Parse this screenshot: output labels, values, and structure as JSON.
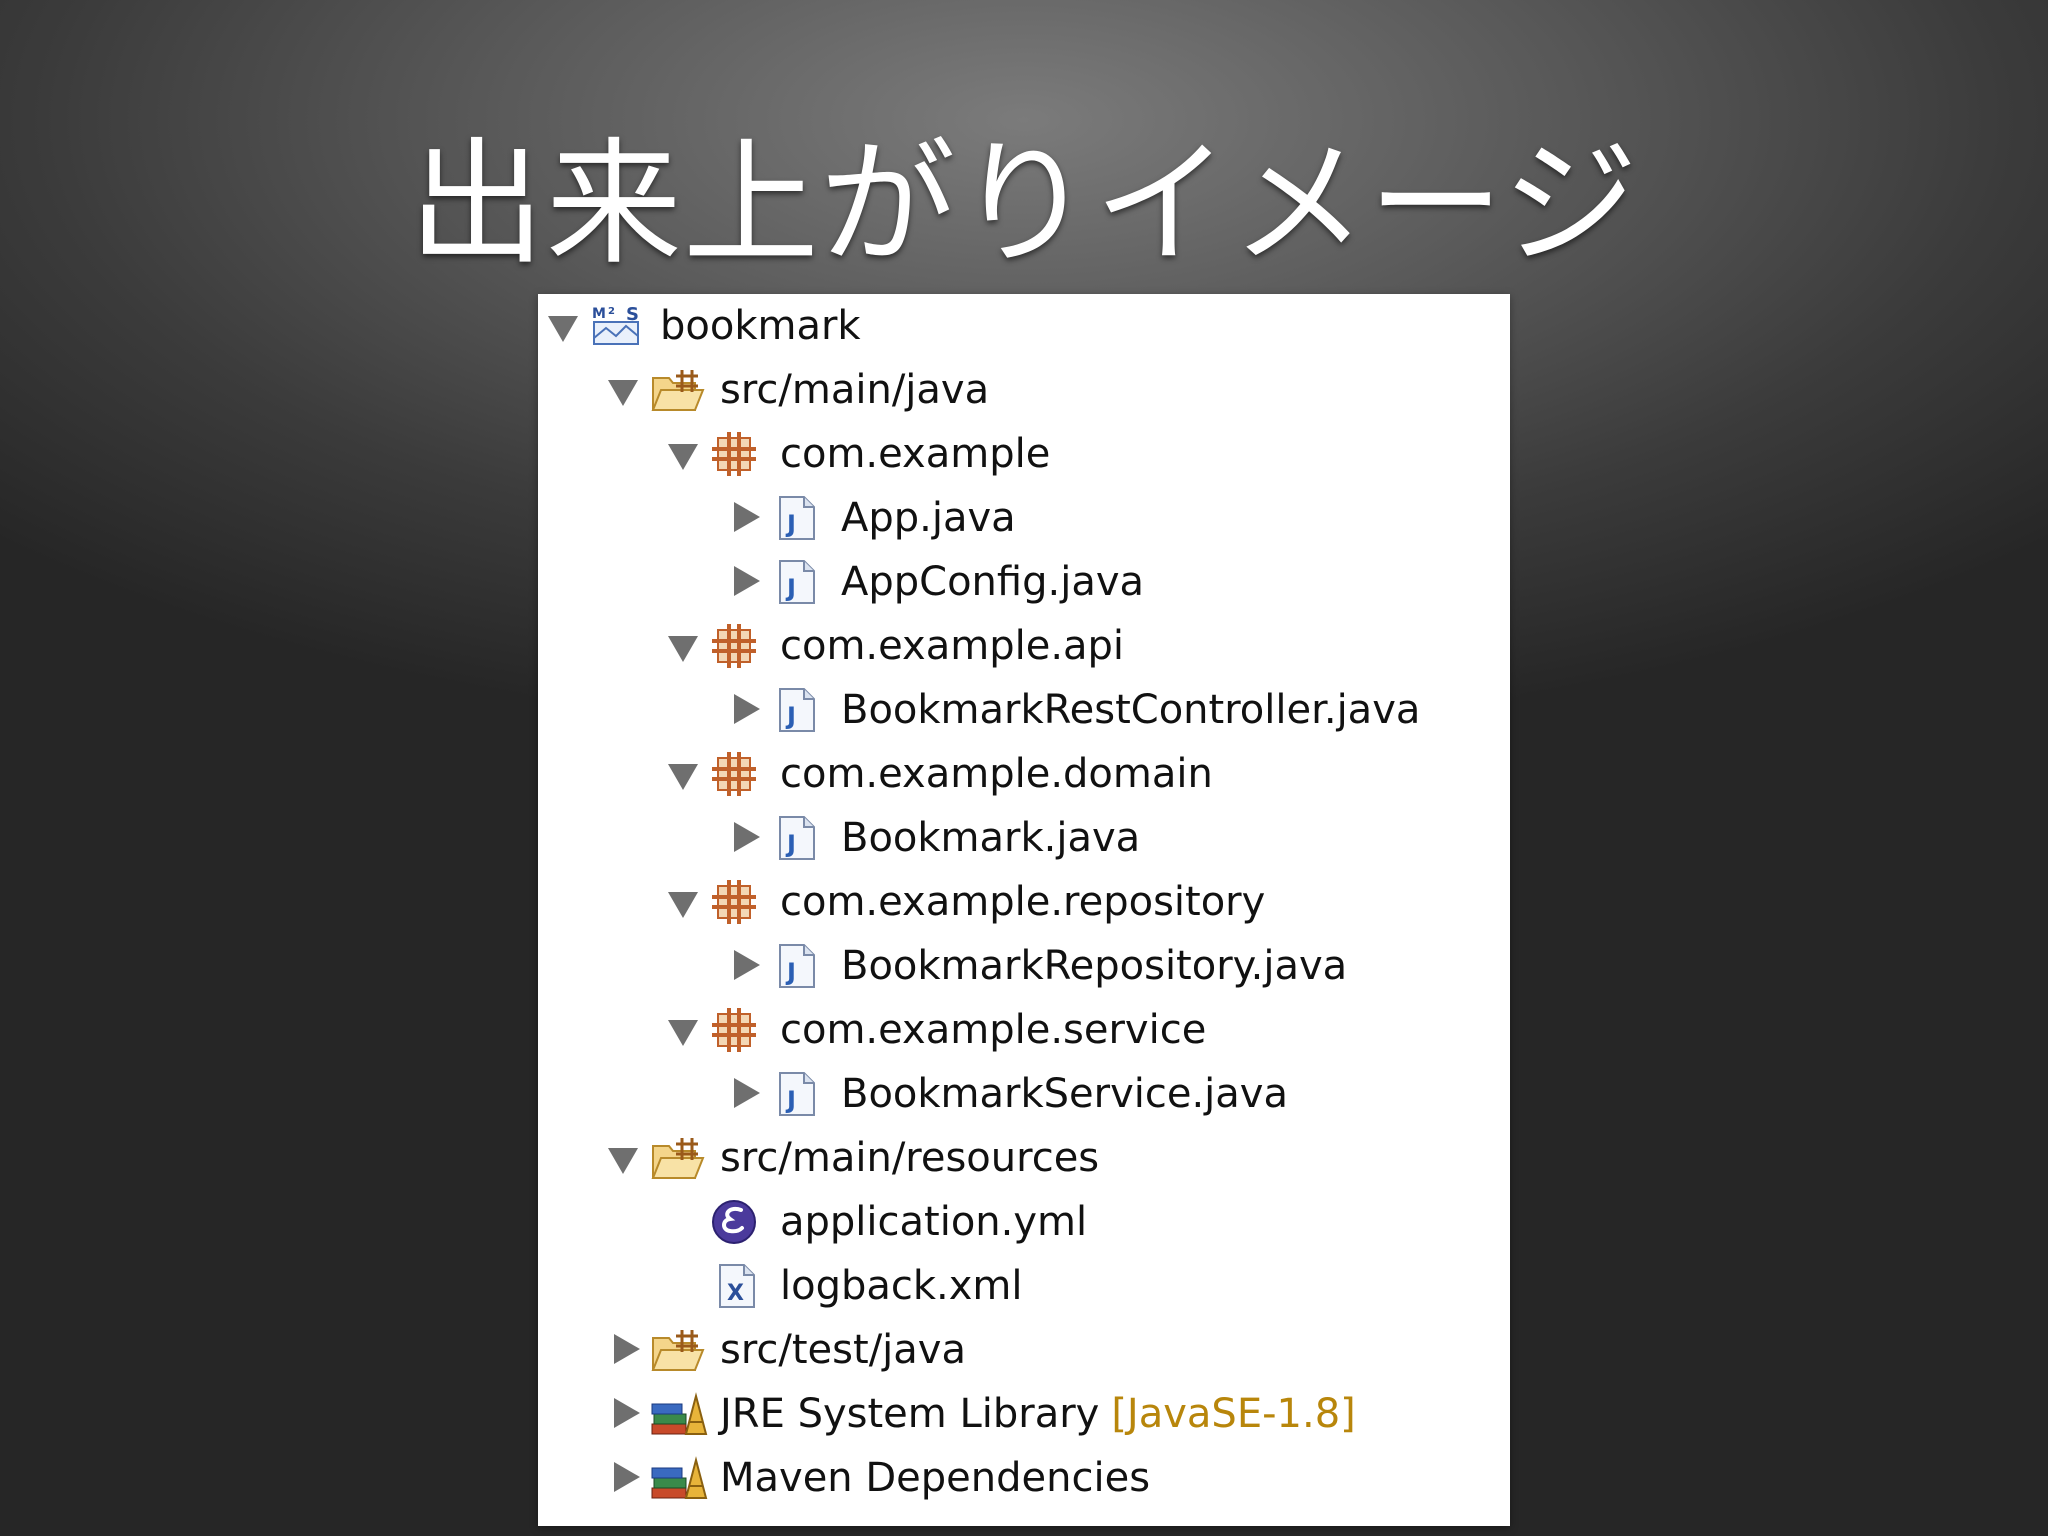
{
  "slide": {
    "title": "出来上がりイメージ"
  },
  "tree": {
    "project": "bookmark",
    "src_main_java": "src/main/java",
    "pkg_com_example": "com.example",
    "file_app_java": "App.java",
    "file_appconfig_java": "AppConfig.java",
    "pkg_api": "com.example.api",
    "file_bookmark_rest_controller": "BookmarkRestController.java",
    "pkg_domain": "com.example.domain",
    "file_bookmark_java": "Bookmark.java",
    "pkg_repository": "com.example.repository",
    "file_bookmark_repository": "BookmarkRepository.java",
    "pkg_service": "com.example.service",
    "file_bookmark_service": "BookmarkService.java",
    "src_main_resources": "src/main/resources",
    "file_application_yml": "application.yml",
    "file_logback_xml": "logback.xml",
    "src_test_java": "src/test/java",
    "jre_library": "JRE System Library",
    "jre_decoration": "[JavaSE-1.8]",
    "maven_dependencies": "Maven Dependencies"
  },
  "icons": {
    "project": "maven-project-icon",
    "source_folder": "source-folder-icon",
    "package": "package-icon",
    "java_file": "java-file-icon",
    "yml_file": "yaml-file-icon",
    "xml_file": "xml-file-icon",
    "library": "library-icon"
  },
  "colors": {
    "background_center": "#7b7b7b",
    "background_edge": "#262626",
    "title_text": "#ffffff",
    "panel_bg": "#ffffff",
    "decoration_text": "#b8860b",
    "package_icon": "#c0602a",
    "java_icon": "#2b5fb4"
  }
}
